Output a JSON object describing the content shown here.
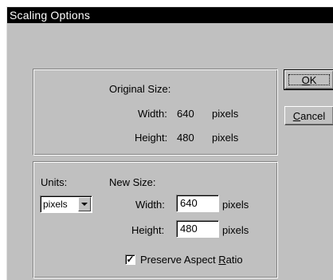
{
  "window": {
    "title": "Scaling Options"
  },
  "original": {
    "heading": "Original Size:",
    "width_label": "Width:",
    "width_value": "640",
    "width_unit": "pixels",
    "height_label": "Height:",
    "height_value": "480",
    "height_unit": "pixels"
  },
  "units": {
    "label": "Units:",
    "selected": "pixels"
  },
  "new_size": {
    "heading": "New Size:",
    "width_label": "Width:",
    "width_value": "640",
    "width_unit": "pixels",
    "height_label": "Height:",
    "height_value": "480",
    "height_unit": "pixels"
  },
  "preserve": {
    "label_pre": "Preserve Aspect ",
    "label_u": "R",
    "label_post": "atio",
    "checked": true,
    "mark": "✓"
  },
  "buttons": {
    "ok_u": "O",
    "ok_rest": "K",
    "cancel_u": "C",
    "cancel_rest": "ancel"
  }
}
